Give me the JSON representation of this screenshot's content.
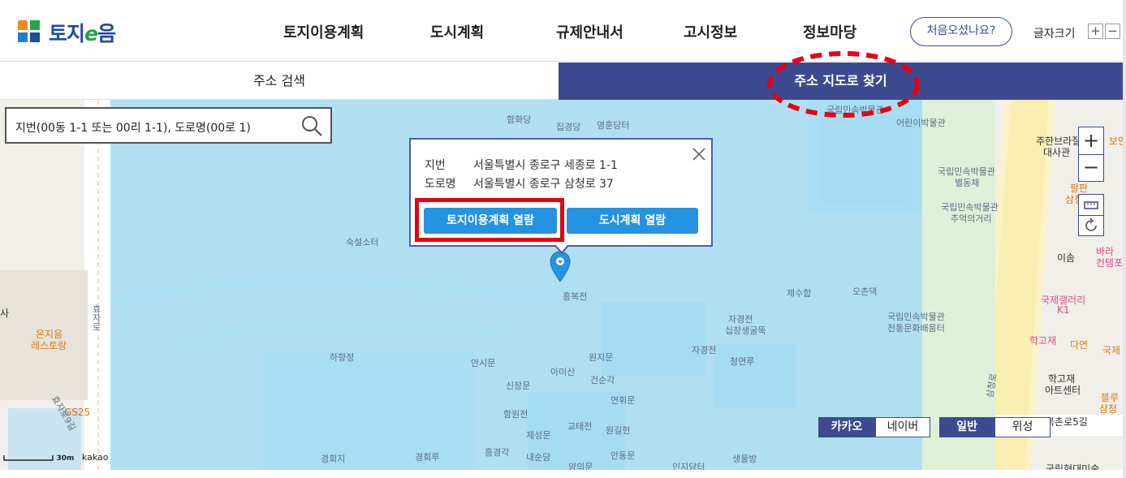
{
  "header": {
    "logo_text_a": "토지",
    "logo_text_e": "e",
    "logo_text_b": "음",
    "nav": [
      "토지이용계획",
      "도시계획",
      "규제안내서",
      "고시정보",
      "정보마당"
    ],
    "first_visit_label": "처음오셨나요?",
    "font_size_label": "글자크기",
    "font_plus": "+",
    "font_minus": "−"
  },
  "tabs": {
    "address_search": "주소 검색",
    "map_search": "주소 지도로 찾기"
  },
  "search": {
    "placeholder": "지번(00동 1-1 또는 00리 1-1), 도로명(00로 1)"
  },
  "popup": {
    "jibun_label": "지번",
    "jibun_value": "서울특별시 종로구 세종로 1-1",
    "road_label": "도로명",
    "road_value": "서울특별시 종로구 삼청로 37",
    "land_use_btn": "토지이용계획 열람",
    "urban_plan_btn": "도시계획 열람"
  },
  "map_controls": {
    "zoom_in": "+",
    "zoom_out": "−",
    "kakao": "카카오",
    "naver": "네이버",
    "normal": "일반",
    "satellite": "위성"
  },
  "scale": {
    "distance": "30m",
    "provider": "kakao"
  },
  "map_labels": [
    "함화당",
    "집경당",
    "영훈당터",
    "국립민속박물관",
    "어린이박물관",
    "국립민속박물관",
    "별동채",
    "국립민속박물관",
    "추억의거리",
    "숙설소터",
    "흥복전",
    "제수합",
    "오촌댁",
    "자경전",
    "십장생굴뚝",
    "국립민속박물관",
    "전통문화배움터",
    "하향정",
    "안시문",
    "아미산",
    "원지문",
    "자경전",
    "청연루",
    "신장문",
    "건순각",
    "연휘문",
    "함원전",
    "제성문",
    "교태전",
    "원길헌",
    "흠경각",
    "내순당",
    "양의문",
    "안동문",
    "인지당터",
    "생물방",
    "경회지",
    "경회루",
    "효자로",
    "주한브라질",
    "대사관",
    "보안",
    "팔판",
    "삼청",
    "이솜",
    "바라",
    "컨템포",
    "국제갤러리",
    "K1",
    "학고재",
    "다연",
    "국제",
    "학고재",
    "아트센터",
    "블루",
    "삼청",
    "북촌로5길",
    "국립현대미술",
    "온지음",
    "레스토랑",
    "GS25",
    "사",
    "효자로9길",
    "삼청로"
  ],
  "colors": {
    "nav_blue": "#3d4a8f",
    "button_blue": "#2493e2",
    "highlight_red": "#e60012",
    "map_overlay": "#a6ddf2"
  }
}
